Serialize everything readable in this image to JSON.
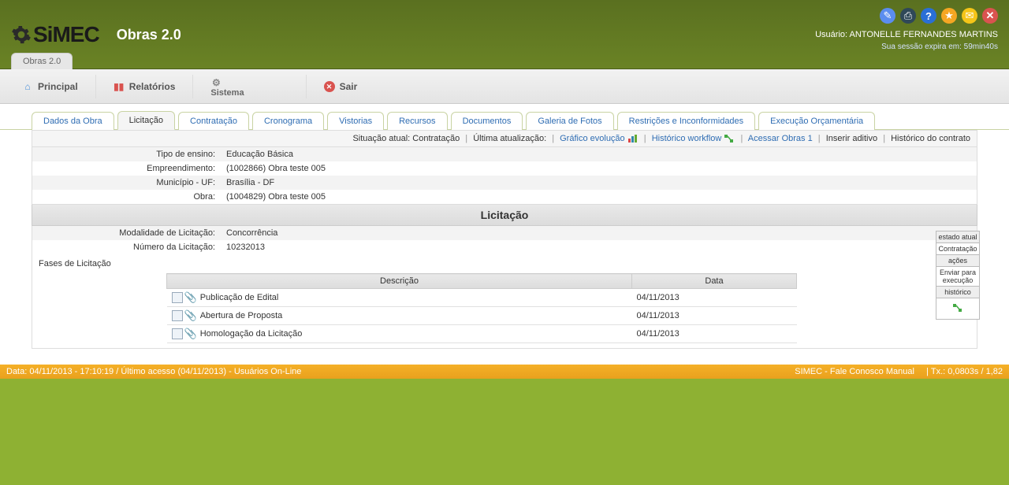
{
  "header": {
    "logo_text": "SiMEC",
    "app_name": "Obras 2.0",
    "breadcrumb": "Obras 2.0",
    "user_prefix": "Usuário:",
    "user_name": "ANTONELLE FERNANDES MARTINS",
    "session": "Sua sessão expira em: 59min40s"
  },
  "menu": {
    "principal": "Principal",
    "relatorios": "Relatórios",
    "sistema": "Sistema",
    "sair": "Sair"
  },
  "tabs": [
    "Dados da Obra",
    "Licitação",
    "Contratação",
    "Cronograma",
    "Vistorias",
    "Recursos",
    "Documentos",
    "Galeria de Fotos",
    "Restrições e Inconformidades",
    "Execução Orçamentária"
  ],
  "active_tab_index": 1,
  "status_bar": {
    "situacao_label": "Situação atual:",
    "situacao_value": "Contratação",
    "ultima_label": "Última atualização:",
    "grafico": "Gráfico evolução",
    "historico_wf": "Histórico workflow",
    "acessar": "Acessar Obras 1",
    "inserir": "Inserir aditivo",
    "historico_contrato": "Histórico do contrato"
  },
  "info": {
    "tipo_ensino_label": "Tipo de ensino:",
    "tipo_ensino_value": "Educação Básica",
    "empreendimento_label": "Empreendimento:",
    "empreendimento_value": "(1002866) Obra teste 005",
    "municipio_label": "Município - UF:",
    "municipio_value": "Brasília - DF",
    "obra_label": "Obra:",
    "obra_value": "(1004829) Obra teste 005"
  },
  "section_title": "Licitação",
  "licitacao": {
    "modalidade_label": "Modalidade de Licitação:",
    "modalidade_value": "Concorrência",
    "numero_label": "Número da Licitação:",
    "numero_value": "10232013",
    "fases_label": "Fases de Licitação"
  },
  "fases_headers": {
    "descricao": "Descrição",
    "data": "Data"
  },
  "fases": [
    {
      "descricao": "Publicação de Edital",
      "data": "04/11/2013"
    },
    {
      "descricao": "Abertura de Proposta",
      "data": "04/11/2013"
    },
    {
      "descricao": "Homologação da Licitação",
      "data": "04/11/2013"
    }
  ],
  "side": {
    "estado": "estado atual",
    "contratacao": "Contratação",
    "acoes": "ações",
    "enviar": "Enviar para execução",
    "historico": "histórico"
  },
  "footer": {
    "left": "Data: 04/11/2013 - 17:10:19 / Último acesso (04/11/2013) - Usuários On-Line",
    "simec": "SIMEC",
    "fale": "Fale Conosco",
    "manual": "Manual",
    "tx": "| Tx.: 0,0803s / 1,82"
  }
}
